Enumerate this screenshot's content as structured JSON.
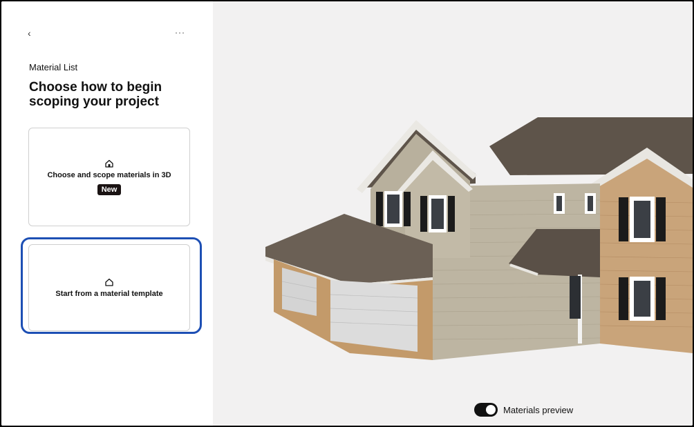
{
  "nav": {
    "back": "‹",
    "more": "···",
    "back_icon": "chevron-left-icon",
    "more_icon": "ellipsis-icon"
  },
  "header": {
    "kicker": "Material List",
    "title": "Choose how to begin scoping your project"
  },
  "options": [
    {
      "label": "Choose and scope materials in 3D",
      "badge": "New",
      "icon": "house-icon"
    },
    {
      "label": "Start from a material template",
      "icon": "house-outline-icon"
    }
  ],
  "viewer": {
    "toggle_label": "Materials preview",
    "toggle_on": true
  },
  "colors": {
    "focus": "#1d4fb4",
    "badge_bg": "#1a1313",
    "viewer_bg": "#f2f1f1"
  }
}
